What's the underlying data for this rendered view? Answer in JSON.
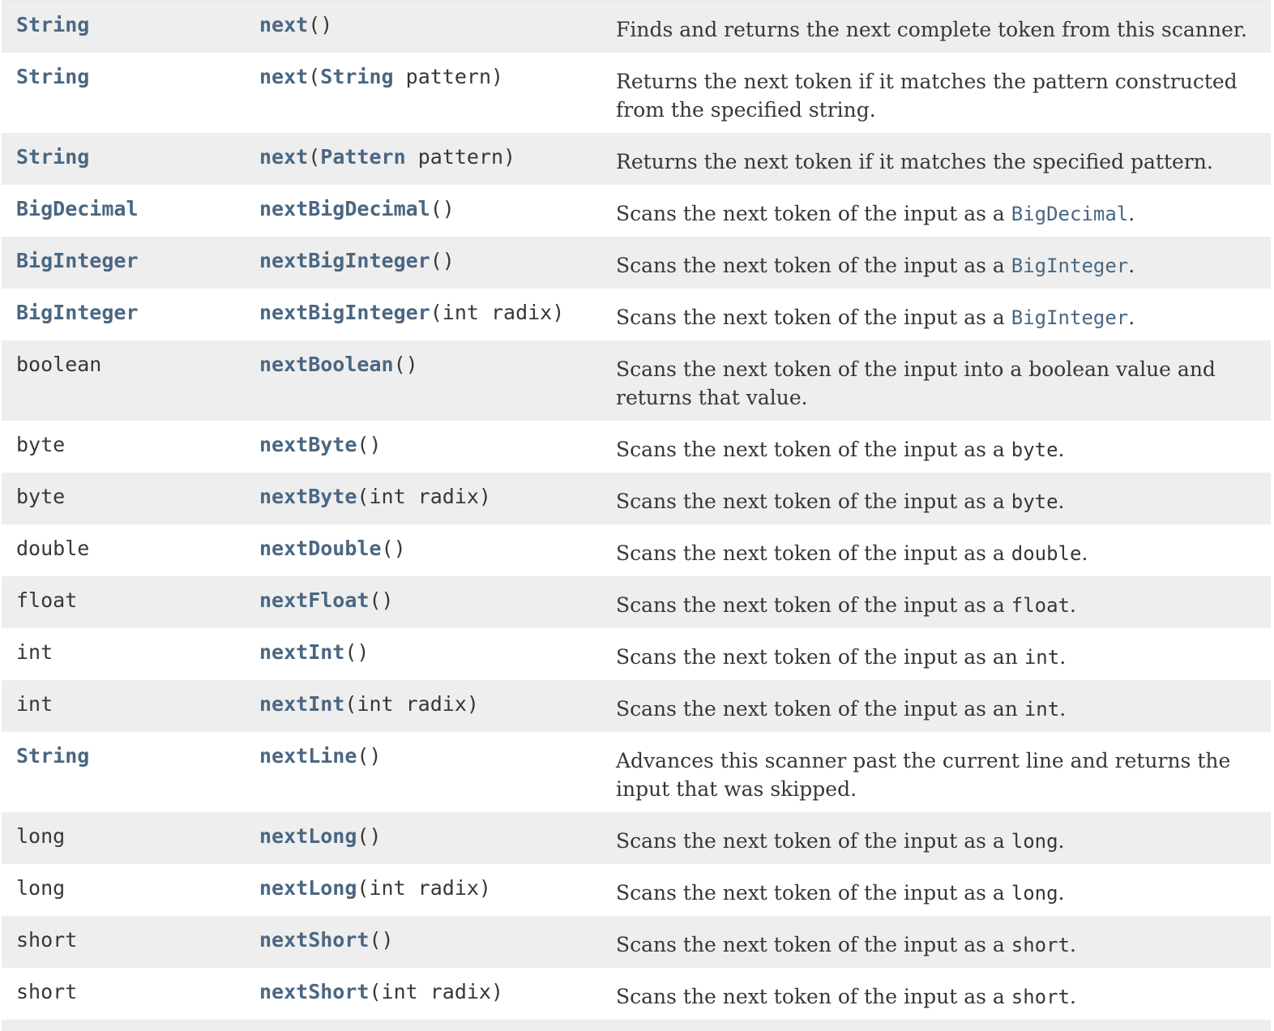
{
  "rows": [
    {
      "type": "String",
      "type_link": true,
      "name": "next",
      "params": [
        {
          "text": "()"
        }
      ],
      "desc": [
        {
          "text": "Finds and returns the next complete token from this scanner."
        }
      ],
      "lines": 1
    },
    {
      "type": "String",
      "type_link": true,
      "name": "next",
      "params": [
        {
          "text": "("
        },
        {
          "text": "String",
          "link": true
        },
        {
          "text": " pattern)"
        }
      ],
      "desc": [
        {
          "text": "Returns the next token if it matches the pattern constructed from the specified string."
        }
      ],
      "lines": 2
    },
    {
      "type": "String",
      "type_link": true,
      "name": "next",
      "params": [
        {
          "text": "("
        },
        {
          "text": "Pattern",
          "link": true
        },
        {
          "text": " pattern)"
        }
      ],
      "desc": [
        {
          "text": "Returns the next token if it matches the specified pattern."
        }
      ],
      "lines": 1
    },
    {
      "type": "BigDecimal",
      "type_link": true,
      "name": "nextBigDecimal",
      "params": [
        {
          "text": "()"
        }
      ],
      "desc": [
        {
          "text": "Scans the next token of the input as a "
        },
        {
          "text": "BigDecimal",
          "link": true
        },
        {
          "text": "."
        }
      ],
      "lines": 1
    },
    {
      "type": "BigInteger",
      "type_link": true,
      "name": "nextBigInteger",
      "params": [
        {
          "text": "()"
        }
      ],
      "desc": [
        {
          "text": "Scans the next token of the input as a "
        },
        {
          "text": "BigInteger",
          "link": true
        },
        {
          "text": "."
        }
      ],
      "lines": 1
    },
    {
      "type": "BigInteger",
      "type_link": true,
      "name": "nextBigInteger",
      "params": [
        {
          "text": "(int radix)"
        }
      ],
      "desc": [
        {
          "text": "Scans the next token of the input as a "
        },
        {
          "text": "BigInteger",
          "link": true
        },
        {
          "text": "."
        }
      ],
      "lines": 1
    },
    {
      "type": "boolean",
      "type_link": false,
      "name": "nextBoolean",
      "params": [
        {
          "text": "()"
        }
      ],
      "desc": [
        {
          "text": "Scans the next token of the input into a boolean value and returns that value."
        }
      ],
      "lines": 2
    },
    {
      "type": "byte",
      "type_link": false,
      "name": "nextByte",
      "params": [
        {
          "text": "()"
        }
      ],
      "desc": [
        {
          "text": "Scans the next token of the input as a "
        },
        {
          "text": "byte",
          "code": true
        },
        {
          "text": "."
        }
      ],
      "lines": 1
    },
    {
      "type": "byte",
      "type_link": false,
      "name": "nextByte",
      "params": [
        {
          "text": "(int radix)"
        }
      ],
      "desc": [
        {
          "text": "Scans the next token of the input as a "
        },
        {
          "text": "byte",
          "code": true
        },
        {
          "text": "."
        }
      ],
      "lines": 1
    },
    {
      "type": "double",
      "type_link": false,
      "name": "nextDouble",
      "params": [
        {
          "text": "()"
        }
      ],
      "desc": [
        {
          "text": "Scans the next token of the input as a "
        },
        {
          "text": "double",
          "code": true
        },
        {
          "text": "."
        }
      ],
      "lines": 1
    },
    {
      "type": "float",
      "type_link": false,
      "name": "nextFloat",
      "params": [
        {
          "text": "()"
        }
      ],
      "desc": [
        {
          "text": "Scans the next token of the input as a "
        },
        {
          "text": "float",
          "code": true
        },
        {
          "text": "."
        }
      ],
      "lines": 1
    },
    {
      "type": "int",
      "type_link": false,
      "name": "nextInt",
      "params": [
        {
          "text": "()"
        }
      ],
      "desc": [
        {
          "text": "Scans the next token of the input as an "
        },
        {
          "text": "int",
          "code": true
        },
        {
          "text": "."
        }
      ],
      "lines": 1
    },
    {
      "type": "int",
      "type_link": false,
      "name": "nextInt",
      "params": [
        {
          "text": "(int radix)"
        }
      ],
      "desc": [
        {
          "text": "Scans the next token of the input as an "
        },
        {
          "text": "int",
          "code": true
        },
        {
          "text": "."
        }
      ],
      "lines": 1
    },
    {
      "type": "String",
      "type_link": true,
      "name": "nextLine",
      "params": [
        {
          "text": "()"
        }
      ],
      "desc": [
        {
          "text": "Advances this scanner past the current line and returns the input that was skipped."
        }
      ],
      "lines": 2
    },
    {
      "type": "long",
      "type_link": false,
      "name": "nextLong",
      "params": [
        {
          "text": "()"
        }
      ],
      "desc": [
        {
          "text": "Scans the next token of the input as a "
        },
        {
          "text": "long",
          "code": true
        },
        {
          "text": "."
        }
      ],
      "lines": 1
    },
    {
      "type": "long",
      "type_link": false,
      "name": "nextLong",
      "params": [
        {
          "text": "(int radix)"
        }
      ],
      "desc": [
        {
          "text": "Scans the next token of the input as a "
        },
        {
          "text": "long",
          "code": true
        },
        {
          "text": "."
        }
      ],
      "lines": 1
    },
    {
      "type": "short",
      "type_link": false,
      "name": "nextShort",
      "params": [
        {
          "text": "()"
        }
      ],
      "desc": [
        {
          "text": "Scans the next token of the input as a "
        },
        {
          "text": "short",
          "code": true
        },
        {
          "text": "."
        }
      ],
      "lines": 1
    },
    {
      "type": "short",
      "type_link": false,
      "name": "nextShort",
      "params": [
        {
          "text": "(int radix)"
        }
      ],
      "desc": [
        {
          "text": "Scans the next token of the input as a "
        },
        {
          "text": "short",
          "code": true
        },
        {
          "text": "."
        }
      ],
      "lines": 1
    }
  ],
  "colors": {
    "link": "#4a6782",
    "text": "#353833",
    "row_alt": "#eeeeee",
    "row_plain": "#ffffff"
  }
}
